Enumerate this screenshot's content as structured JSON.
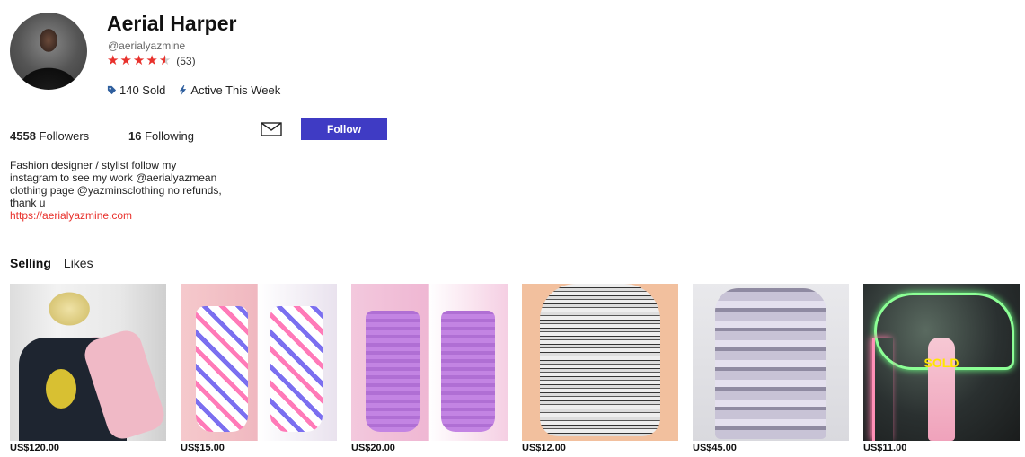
{
  "profile": {
    "name": "Aerial Harper",
    "handle": "@aerialyazmine",
    "rating_value": 4.5,
    "review_count": "(53)",
    "sold": "140 Sold",
    "activity": "Active This Week"
  },
  "follow": {
    "followers_count": "4558",
    "followers_label": "Followers",
    "following_count": "16",
    "following_label": "Following",
    "button_label": "Follow"
  },
  "bio": {
    "line1": "Fashion designer / stylist follow my",
    "line2": "instagram to see my work @aerialyazmean",
    "line3": "clothing page @yazminsclothing no refunds,",
    "line4": "thank u",
    "link": "https://aerialyazmine.com"
  },
  "tabs": [
    "Selling",
    "Likes"
  ],
  "items": [
    {
      "price": "US$120.00",
      "sold": ""
    },
    {
      "price": "US$15.00",
      "sold": ""
    },
    {
      "price": "US$20.00",
      "sold": ""
    },
    {
      "price": "US$12.00",
      "sold": ""
    },
    {
      "price": "US$45.00",
      "sold": ""
    },
    {
      "price": "US$11.00",
      "sold": "SOLD"
    }
  ],
  "icons": {
    "tag": "tag-icon",
    "bolt": "bolt-icon",
    "mail": "mail-icon",
    "star": "star-icon"
  },
  "colors": {
    "accent_button": "#3f3bc4",
    "star": "#e8312c",
    "link": "#e8312c",
    "sold_label": "#ffe600"
  }
}
